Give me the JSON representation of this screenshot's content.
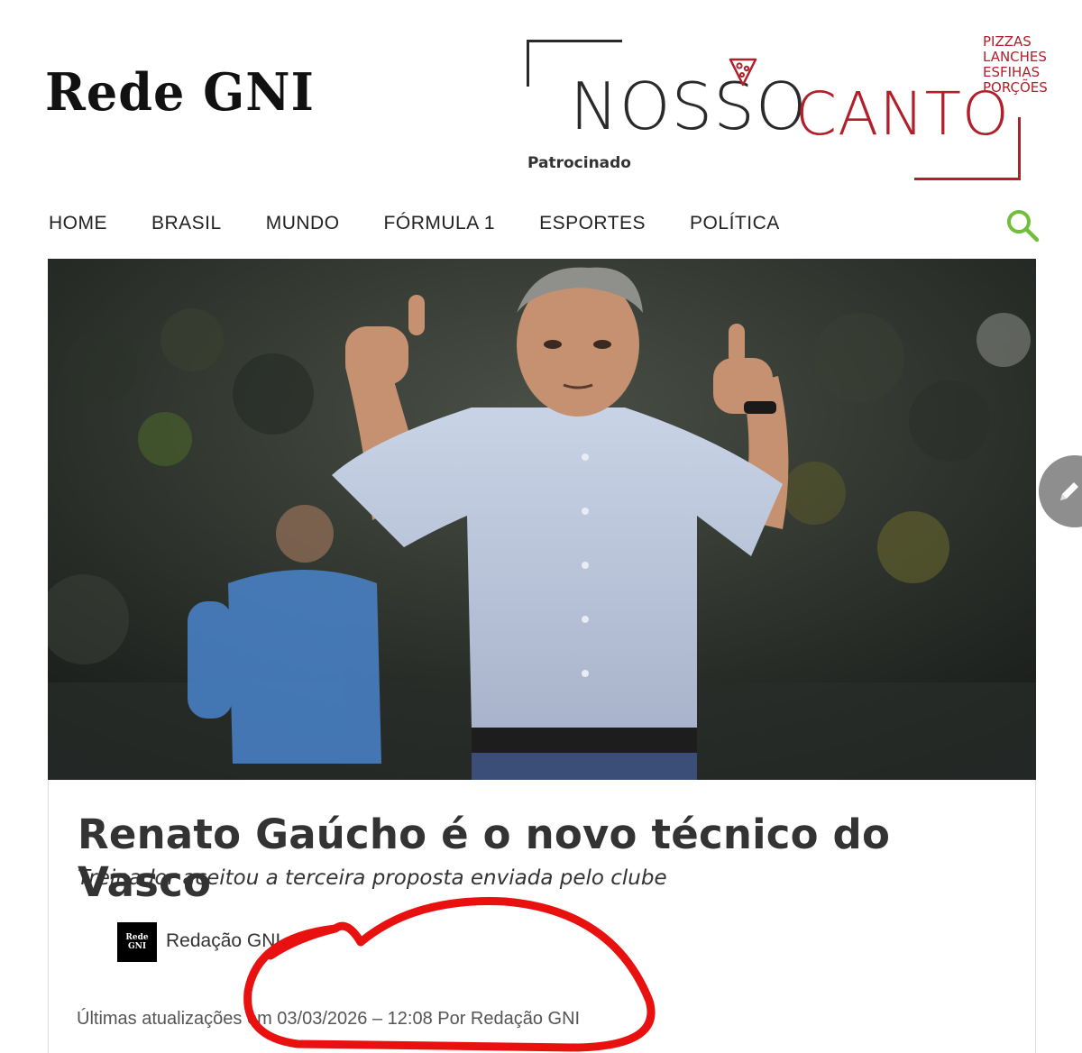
{
  "site": {
    "logo_text": "Rede GNI"
  },
  "sponsor": {
    "brand_left": "NOSSO",
    "brand_right": "CANTO",
    "menu_words": [
      "PIZZAS",
      "LANCHES",
      "ESFIHAS",
      "PORÇÕES"
    ],
    "label": "Patrocinado",
    "colors": {
      "dark": "#2a2a2a",
      "red": "#b1202a"
    }
  },
  "nav": {
    "items": [
      "HOME",
      "BRASIL",
      "MUNDO",
      "FÓRMULA 1",
      "ESPORTES",
      "POLÍTICA"
    ],
    "search_icon": "search-icon",
    "search_color": "#6fbf3a"
  },
  "hero_image": {
    "description_icon": "photo"
  },
  "article": {
    "headline": "Renato Gaúcho é o novo técnico do Vasco",
    "subheadline": "Treinador aceitou a terceira proposta enviada pelo clube",
    "author_avatar_text": "Rede GNI",
    "author_name": "Redação GNI",
    "updated_line": "Últimas atualizações em 03/03/2026 – 12:08 Por Redação GNI"
  },
  "floating_button": {
    "icon": "pencil-icon"
  },
  "annotation": {
    "color": "#e8110f"
  }
}
